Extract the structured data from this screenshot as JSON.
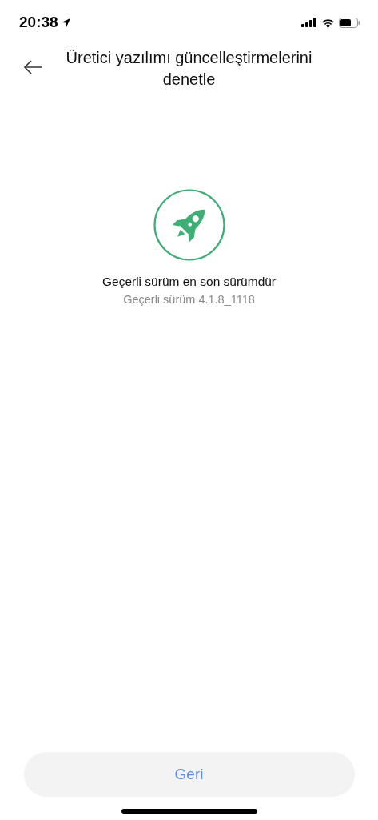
{
  "status_bar": {
    "time": "20:38"
  },
  "header": {
    "title": "Üretici yazılımı güncelleştirmelerini denetle"
  },
  "status": {
    "message": "Geçerli sürüm en son sürümdür",
    "version": "Geçerli sürüm 4.1.8_1118"
  },
  "buttons": [
    {
      "label": "Geri"
    }
  ]
}
